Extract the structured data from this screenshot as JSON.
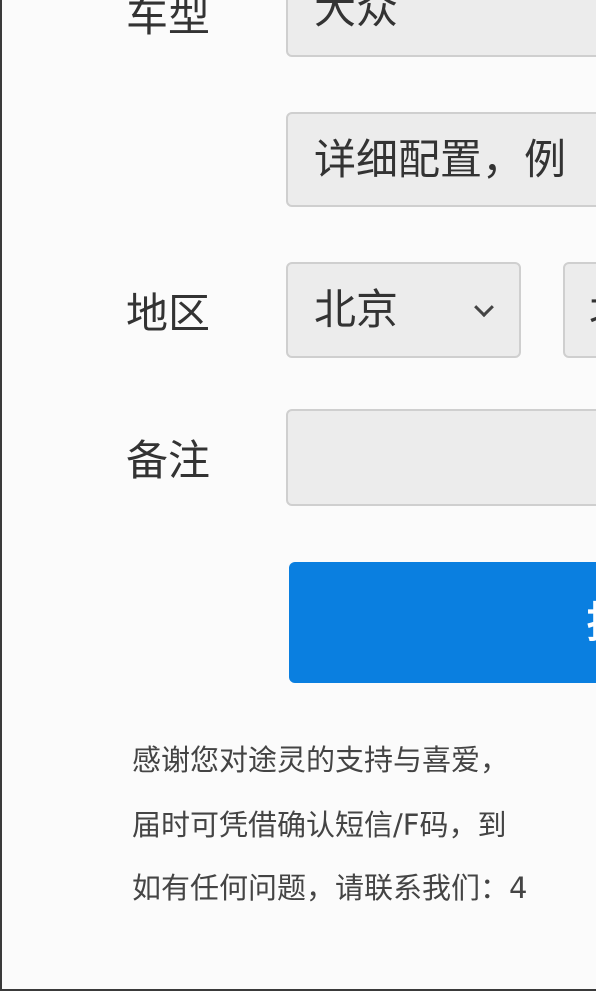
{
  "form": {
    "car_model": {
      "label": "车型",
      "value": "大众"
    },
    "config": {
      "placeholder": "详细配置，例"
    },
    "region": {
      "label": "地区",
      "province": "北京",
      "city": "北"
    },
    "remark": {
      "label": "备注",
      "value": ""
    },
    "submit_label": "提"
  },
  "notice": {
    "line1": "感谢您对途灵的支持与喜爱，",
    "line2": "届时可凭借确认短信/F码，到",
    "line3": "如有任何问题，请联系我们：4"
  }
}
